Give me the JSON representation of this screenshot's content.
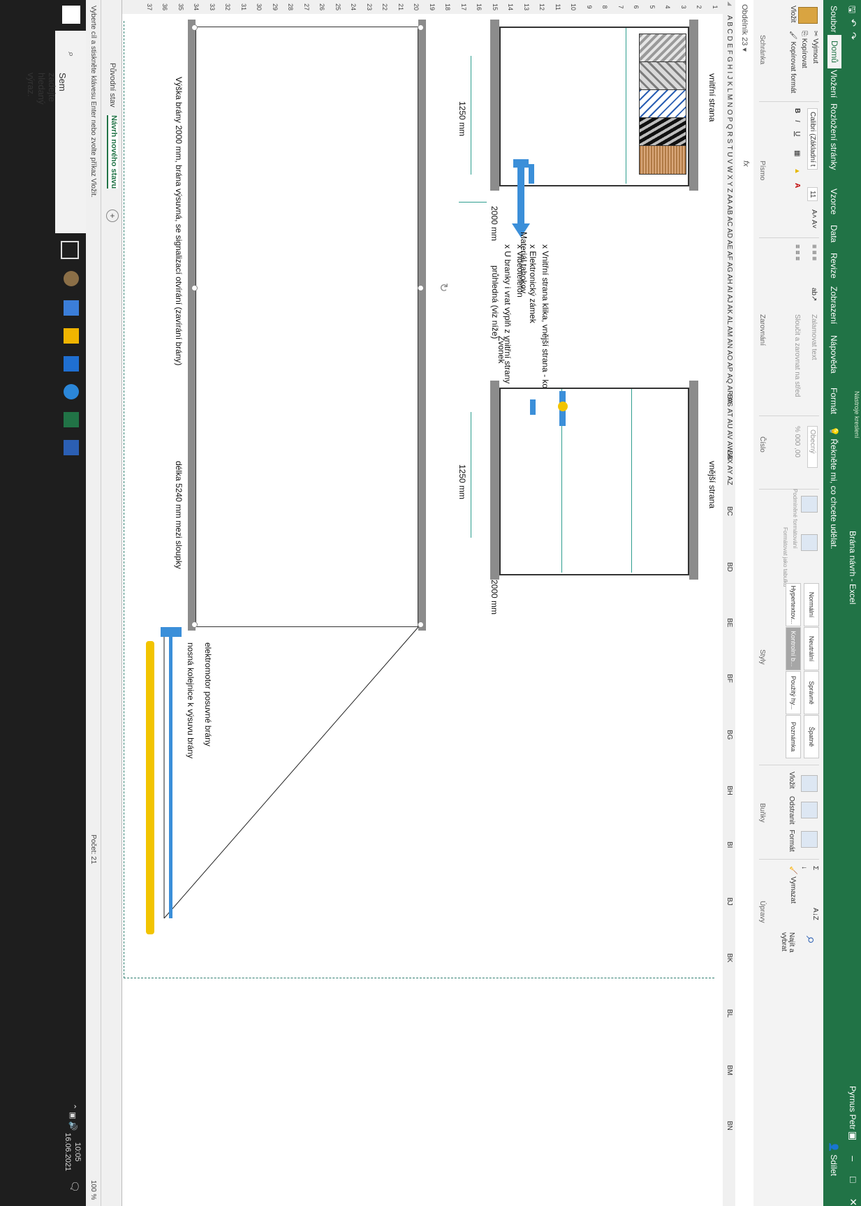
{
  "window": {
    "title": "Brána návrh - Excel",
    "context_tab_group": "Nástroje kreslení",
    "user": "Pyrnus Petr"
  },
  "tabs": [
    "Soubor",
    "Domů",
    "Vložení",
    "Rozložení stránky",
    "Vzorce",
    "Data",
    "Revize",
    "Zobrazení",
    "Nápověda",
    "Formát"
  ],
  "tell_me": "Řekněte mi, co chcete udělat.",
  "share": "Sdílet",
  "ribbon": {
    "clipboard": {
      "paste": "Vložit",
      "cut": "Vyjmout",
      "copy": "Kopírovat",
      "format_painter": "Kopírovat formát",
      "label": "Schránka"
    },
    "font": {
      "name": "Calibri (Základní t",
      "size": "11",
      "label": "Písmo"
    },
    "alignment": {
      "wrap": "Zalamovat text",
      "merge": "Sloučit a zarovnat na střed",
      "label": "Zarovnání"
    },
    "number": {
      "format": "Obecný",
      "label": "Číslo"
    },
    "styles": {
      "conditional": "Podmíněné formátování",
      "table": "Formátovat jako tabulku",
      "cells": [
        "Normální",
        "Neutrální",
        "Správně",
        "Špatně",
        "Hypertextov...",
        "Kontrolní b...",
        "Použitý hy...",
        "Poznámka"
      ],
      "label": "Styly"
    },
    "cells": {
      "insert": "Vložit",
      "delete": "Odstranit",
      "format": "Formát",
      "label": "Buňky"
    },
    "editing": {
      "clear": "Vymazat",
      "find": "Najít a vybrat",
      "label": "Úpravy"
    }
  },
  "formula_bar": {
    "name_box": "Obdélník 23",
    "fx": "fx"
  },
  "columns": "A B C D E F G H I J K L M N O P Q R S T U V W X Y Z AA AB AC AD AE AF AG AH AI AJ AK AL AM AN AO AP AQ AR AS AT AU AV AW AX AY AZ",
  "wide_columns": [
    "BA",
    "BB",
    "BC",
    "BD",
    "BE",
    "BF",
    "BG",
    "BH",
    "BI",
    "BJ",
    "BK",
    "BL",
    "BM",
    "BN"
  ],
  "rows": [
    "1",
    "2",
    "3",
    "4",
    "5",
    "6",
    "7",
    "8",
    "9",
    "10",
    "11",
    "12",
    "13",
    "14",
    "15",
    "16",
    "17",
    "18",
    "19",
    "20",
    "21",
    "22",
    "23",
    "24",
    "25",
    "26",
    "27",
    "28",
    "29",
    "30",
    "31",
    "32",
    "33",
    "34",
    "35",
    "36",
    "37"
  ],
  "drawing": {
    "inner_label": "vnitřní strana",
    "outer_label": "vnější strana",
    "width_inner": "1250 mm",
    "width_outer": "1250 mm",
    "height_inner": "2000 mm",
    "height_outer": "2000 mm",
    "material": "Materiál tahokov",
    "bell": "Zvonek",
    "bullets": [
      "x   Vnitřní strana klika, vnější strana - koule",
      "x   Elektronický zámek",
      "x   Videotelefon",
      "x   U branky i vrat výplň z vnitřní strany",
      "průhledná (viz níže)"
    ],
    "motor": "elektromotor posuvné brány",
    "rail": "nosná kolejnice k výsuvu brány",
    "gate_caption": "Výška brány 2000 mm, brána výsuvná, se signalizací otvírání (zavírání brány)",
    "gate_length": "délka 5240 mm mezi sloupky"
  },
  "sheet_tabs": [
    "Původní stav",
    "Návrh nového stavu"
  ],
  "active_sheet": "Návrh nového stavu",
  "status": {
    "message": "Vyberte cíl a stiskněte klávesu Enter nebo zvolte příkaz Vložit.",
    "count": "Počet: 21",
    "zoom": "100 %"
  },
  "taskbar": {
    "search_placeholder": "Sem zadejte hledaný výraz.",
    "time": "10:05",
    "date": "16.06.2021"
  }
}
